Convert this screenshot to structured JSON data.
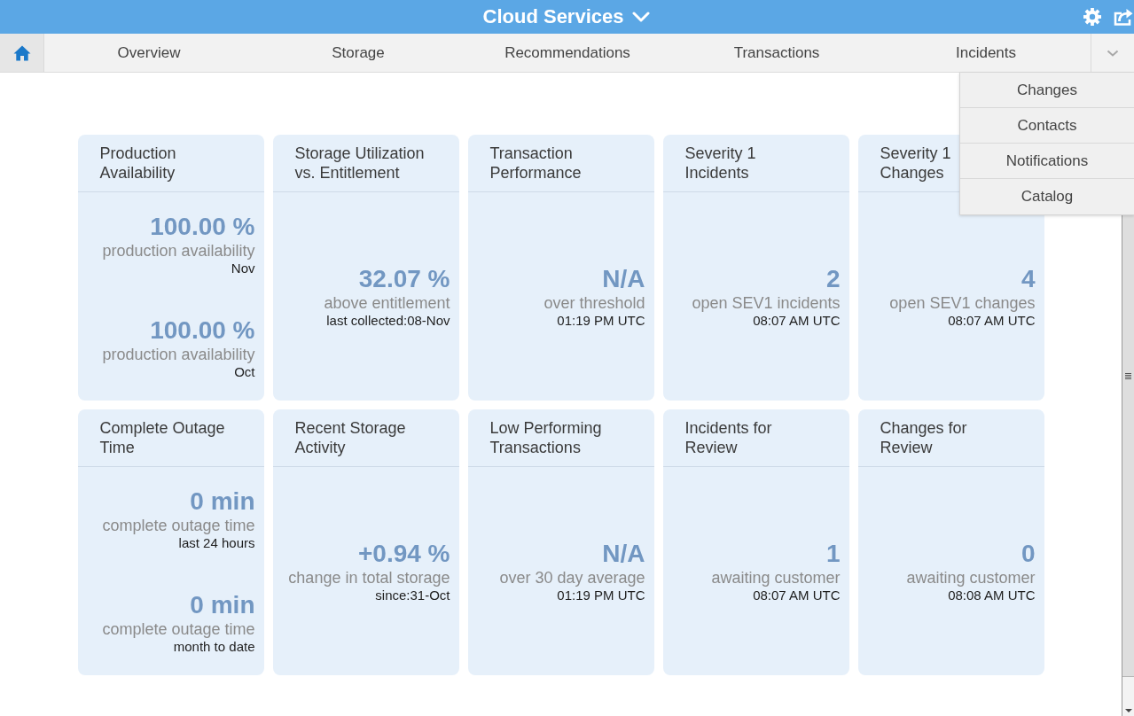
{
  "header": {
    "title": "Cloud Services"
  },
  "nav": {
    "home": {
      "selected": true
    },
    "tabs": [
      {
        "label": "Overview",
        "selected": false
      },
      {
        "label": "Storage",
        "selected": false
      },
      {
        "label": "Recommendations",
        "selected": false
      },
      {
        "label": "Transactions",
        "selected": false
      },
      {
        "label": "Incidents",
        "selected": false
      }
    ],
    "more": {
      "expanded": true,
      "items": [
        "Changes",
        "Contacts",
        "Notifications",
        "Catalog"
      ]
    }
  },
  "tiles": [
    {
      "title": "Production Availability",
      "metrics": [
        {
          "value": "100.00 %",
          "label": "production availability",
          "note": "Nov"
        },
        {
          "value": "100.00 %",
          "label": "production availability",
          "note": "Oct"
        }
      ]
    },
    {
      "title": "Storage Utilization vs. Entitlement",
      "metrics": [
        {
          "value": "32.07 %",
          "label": "above entitlement",
          "note": "last collected:08-Nov"
        }
      ]
    },
    {
      "title": "Transaction Performance",
      "metrics": [
        {
          "value": "N/A",
          "label": "over threshold",
          "note": "01:19 PM UTC"
        }
      ]
    },
    {
      "title": "Severity 1 Incidents",
      "metrics": [
        {
          "value": "2",
          "label": "open SEV1 incidents",
          "note": "08:07 AM UTC"
        }
      ]
    },
    {
      "title": "Severity 1 Changes",
      "metrics": [
        {
          "value": "4",
          "label": "open SEV1 changes",
          "note": "08:07 AM UTC"
        }
      ]
    },
    {
      "title": "Complete Outage Time",
      "metrics": [
        {
          "value": "0 min",
          "label": "complete outage time",
          "note": "last 24 hours"
        },
        {
          "value": "0 min",
          "label": "complete outage time",
          "note": "month to date"
        }
      ]
    },
    {
      "title": "Recent Storage Activity",
      "metrics": [
        {
          "value": "+0.94 %",
          "label": "change in total storage",
          "note": "since:31-Oct"
        }
      ]
    },
    {
      "title": "Low Performing Transactions",
      "metrics": [
        {
          "value": "N/A",
          "label": "over 30 day average",
          "note": "01:19 PM UTC"
        }
      ]
    },
    {
      "title": "Incidents for Review",
      "metrics": [
        {
          "value": "1",
          "label": "awaiting customer",
          "note": "08:07 AM UTC"
        }
      ]
    },
    {
      "title": "Changes for Review",
      "metrics": [
        {
          "value": "0",
          "label": "awaiting customer",
          "note": "08:08 AM UTC"
        }
      ]
    }
  ]
}
